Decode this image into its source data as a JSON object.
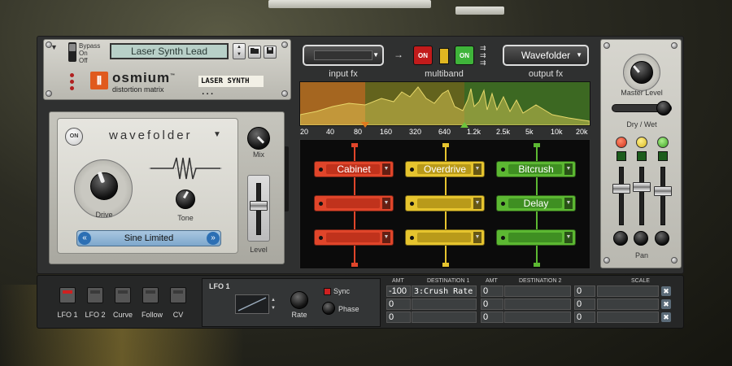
{
  "header": {
    "bypass_options": [
      "Bypass",
      "On",
      "Off"
    ],
    "patch_name": "Laser Synth Lead",
    "up_arrow": "▲",
    "down_arrow": "▼",
    "logo_glyph": "⦀",
    "brand": "osmium",
    "trademark": "™",
    "product": "distortion matrix",
    "tape_label": "LASER SYNTH ..."
  },
  "shaper": {
    "on_label": "ON",
    "title": "wavefolder",
    "drive_label": "Drive",
    "tone_label": "Tone",
    "mix_label": "Mix",
    "level_label": "Level",
    "shape": "Sine Limited",
    "prev": "«",
    "next": "»"
  },
  "router": {
    "input_fx_label": "input fx",
    "multiband_label": "multiband",
    "output_fx_label": "output fx",
    "output_fx_value": "Wavefolder",
    "mb_on1": "ON",
    "mb_on2": "ON",
    "freq_labels": [
      "20",
      "40",
      "80",
      "160",
      "320",
      "640",
      "1.2k",
      "2.5k",
      "5k",
      "10k",
      "20k"
    ]
  },
  "matrix": {
    "columns": [
      {
        "color": "#e0452a",
        "slots": [
          "Cabinet",
          "",
          ""
        ]
      },
      {
        "color": "#e6c42e",
        "slots": [
          "Overdrive",
          "",
          ""
        ]
      },
      {
        "color": "#5cb832",
        "slots": [
          "Bitcrush",
          "Delay",
          ""
        ]
      }
    ]
  },
  "output": {
    "master_label": "Master Level",
    "drywet_label": "Dry / Wet",
    "pan_label": "Pan"
  },
  "mod": {
    "sources": [
      "LFO 1",
      "LFO 2",
      "Curve",
      "Follow",
      "CV"
    ],
    "lfo_title": "LFO 1",
    "sync_label": "Sync",
    "rate_label": "Rate",
    "phase_label": "Phase",
    "headers": {
      "amt1": "AMT",
      "dest1": "DESTINATION 1",
      "amt2": "AMT",
      "dest2": "DESTINATION 2",
      "scale": "SCALE"
    },
    "rows": [
      {
        "amt1": "-100",
        "dest1": "3:Crush Rate",
        "amt2": "0",
        "dest2": "",
        "amt3": "0",
        "scale": ""
      },
      {
        "amt1": "0",
        "dest1": "",
        "amt2": "0",
        "dest2": "",
        "amt3": "0",
        "scale": ""
      },
      {
        "amt1": "0",
        "dest1": "",
        "amt2": "0",
        "dest2": "",
        "amt3": "0",
        "scale": ""
      }
    ],
    "remove": "✖"
  }
}
